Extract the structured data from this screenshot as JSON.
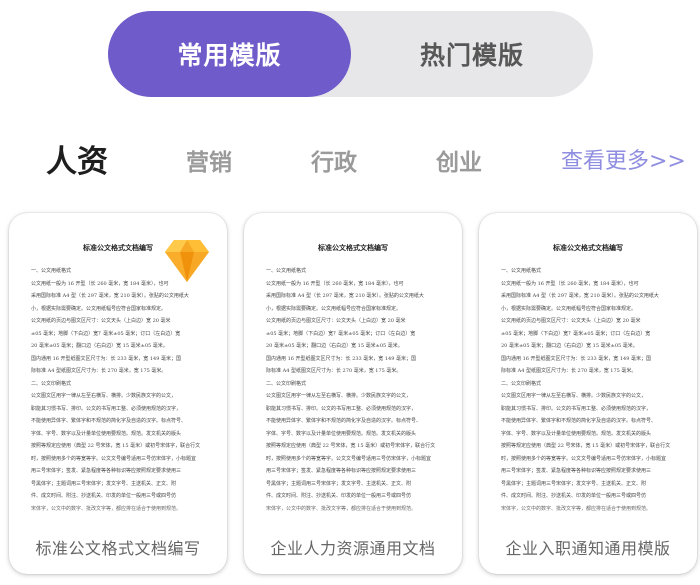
{
  "switch": {
    "active_label": "常用模版",
    "inactive_label": "热门模版",
    "active_color": "#6f5bc9"
  },
  "categories": {
    "items": [
      "人资",
      "营销",
      "行政",
      "创业"
    ],
    "active_index": 0,
    "more_label": "查看更多>>"
  },
  "cards": [
    {
      "caption": "标准公文格式文档编写",
      "premium_badge": "gem-icon"
    },
    {
      "caption": "企业人力资源通用文档"
    },
    {
      "caption": "企业入职通知通用模版"
    }
  ],
  "document_preview": {
    "title": "标准公文格式文档编写",
    "lines": [
      "一、公文用纸格式",
      "公文用纸一般为 16 开型（长 260 毫米，宽 184 毫米），也可",
      "采用国际标准 A4 型（长 297 毫米，宽 210 毫米）。张贴的公文用纸大",
      "小，根据实际需要确定。公文用纸幅号应符合国家标准规定。",
      "公文用纸的页边与图文区尺寸：公文天头（上白边）宽 20 毫米",
      "±05 毫米；地脚（下白边）宽？毫米±05 毫米；订口（左白边）宽",
      "20 毫米±05 毫米；翻口边（右白边）宽 15 毫米±05 毫米。",
      "国内通用 16 开型纸图文区尺寸为：长 233 毫米，宽 149 毫米；国",
      "际标准 A4 型纸图文区尺寸为：长 270 毫米，宽 175 毫米。",
      "二、公文印刷格式",
      "公文图文区用字一律从左至右横写、横排。少数民族文字的公文，",
      "职能其习惯书写、排印。公文的书写用工整、必须使用规范的汉字，",
      "不能使用异体字、繁体字和不规范的简化字及自造的汉字。标点符号、",
      "字体、字号、数字以及计量单位使用要规范。规范。发文机关的版头",
      "按照等规定应使用（典型 22 号宋体，宽 15 毫米）或初号宋体字，联合行文",
      "时，按照使用多个的等宽等字。公文文号编号适用三号仿宋体字，小标题宜",
      "用三号宋体字；签发、紧急程度等各种标识等应按照规定要求使用三",
      "号黑体字；主题词用三号宋体字；发文字号、主送机关、正文、附",
      "件、成文时间、附注、抄送机关、印发的单位一般用三号或四号仿",
      "宋体字，公文中的数字、批改文字等，都应排在适合于使用到规范。"
    ]
  }
}
